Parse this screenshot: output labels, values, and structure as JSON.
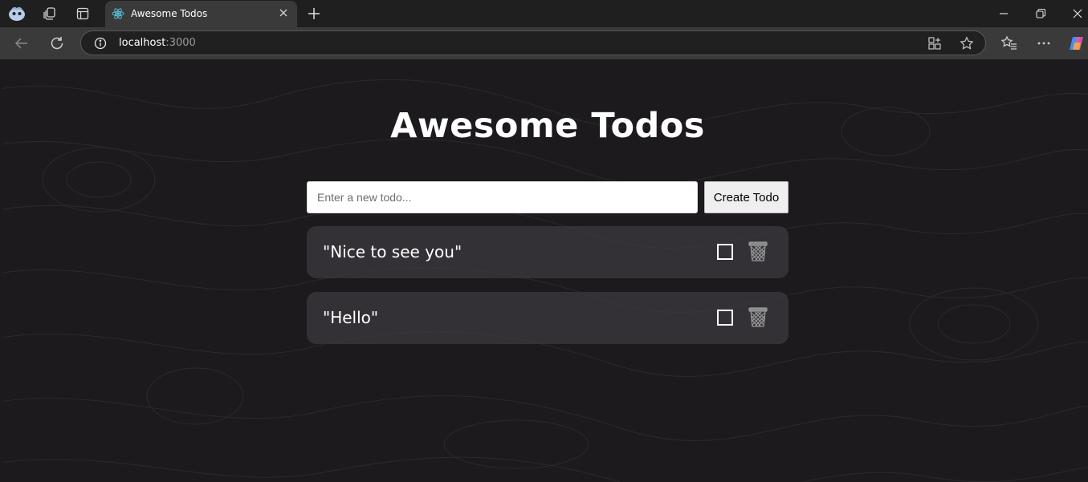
{
  "browser": {
    "tab_title": "Awesome Todos",
    "url_host": "localhost",
    "url_port": ":3000"
  },
  "page": {
    "title": "Awesome Todos",
    "input_placeholder": "Enter a new todo...",
    "create_label": "Create Todo",
    "todos": [
      {
        "text": "\"Nice to see you\"",
        "completed": false
      },
      {
        "text": "\"Hello\"",
        "completed": false
      }
    ]
  },
  "colors": {
    "page_bg": "#1c1a1d",
    "card_bg": "#3c393f",
    "title": "#ffffff"
  }
}
